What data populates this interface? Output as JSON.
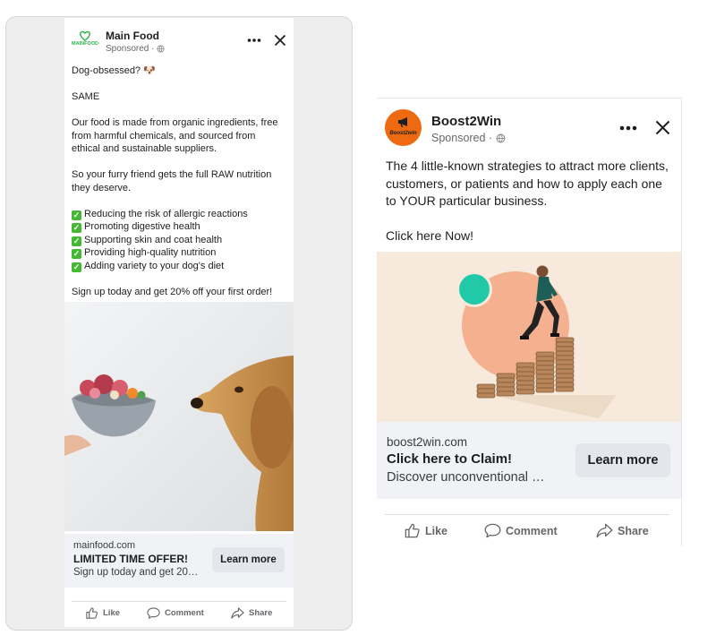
{
  "left_ad": {
    "brand": "Main Food",
    "logo_text": "MAINFOOD",
    "sponsored": "Sponsored ·",
    "body": {
      "line1": "Dog-obsessed? 🐶",
      "line2": "SAME",
      "para1": "Our food is made from organic ingredients, free from harmful chemicals, and sourced from ethical and sustainable suppliers.",
      "para2": "So your furry friend gets the full RAW nutrition they deserve.",
      "benefits": [
        "Reducing the risk of allergic reactions",
        "Promoting digestive health",
        "Supporting skin and coat health",
        "Providing high-quality nutrition",
        "Adding variety to your dog's diet"
      ],
      "closing": "Sign up today and get 20% off your first order!"
    },
    "cta": {
      "domain": "mainfood.com",
      "headline": "LIMITED TIME OFFER!",
      "description": "Sign up today and get 20…",
      "button": "Learn more"
    },
    "actions": {
      "like": "Like",
      "comment": "Comment",
      "share": "Share"
    }
  },
  "right_ad": {
    "brand": "Boost2Win",
    "logo_text": "Boost2win",
    "sponsored": "Sponsored ·",
    "body": {
      "para1": "The 4 little-known strategies to attract more clients, customers, or patients and how to apply each one to YOUR particular business.",
      "para2": "Click here Now!"
    },
    "cta": {
      "domain": "boost2win.com",
      "headline": "Click here to Claim!",
      "description": "Discover unconventional …",
      "button": "Learn more"
    },
    "actions": {
      "like": "Like",
      "comment": "Comment",
      "share": "Share"
    }
  },
  "colors": {
    "mainfood_green": "#2bb24c",
    "boost_orange": "#ee6a10",
    "check_green": "#45b833",
    "cta_bg": "#f0f2f5",
    "button_bg": "#e4e6eb",
    "muted_text": "#65676b"
  },
  "icons": [
    "heart-logo-icon",
    "globe-icon",
    "more-options-icon",
    "close-icon",
    "check-icon",
    "thumbs-up-icon",
    "comment-bubble-icon",
    "share-arrow-icon"
  ]
}
